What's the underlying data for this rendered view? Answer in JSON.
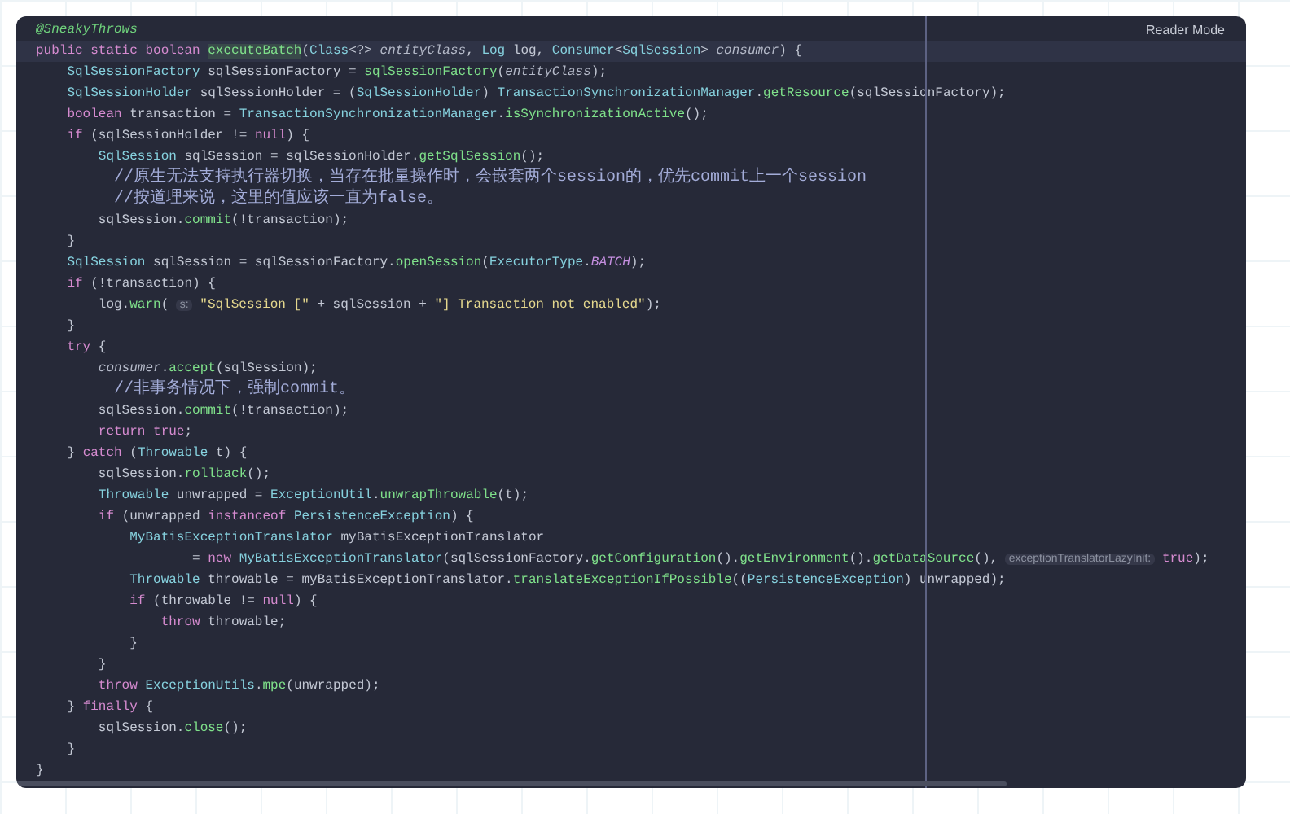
{
  "toolbar": {
    "reader_mode": "Reader Mode"
  },
  "lines": [
    {
      "current": false,
      "tokens": [
        {
          "kind": "annot",
          "text": "@SneakyThrows"
        }
      ]
    },
    {
      "current": true,
      "tokens": [
        {
          "kind": "kw",
          "text": "public static boolean "
        },
        {
          "kind": "fndecl",
          "text": "executeBatch"
        },
        {
          "kind": "plain",
          "text": "("
        },
        {
          "kind": "type",
          "text": "Class"
        },
        {
          "kind": "plain",
          "text": "<?> "
        },
        {
          "kind": "param",
          "text": "entityClass"
        },
        {
          "kind": "plain",
          "text": ", "
        },
        {
          "kind": "type",
          "text": "Log"
        },
        {
          "kind": "plain",
          "text": " log, "
        },
        {
          "kind": "type",
          "text": "Consumer"
        },
        {
          "kind": "plain",
          "text": "<"
        },
        {
          "kind": "type",
          "text": "SqlSession"
        },
        {
          "kind": "plain",
          "text": "> "
        },
        {
          "kind": "param",
          "text": "consumer"
        },
        {
          "kind": "plain",
          "text": ") {"
        }
      ]
    },
    {
      "current": false,
      "tokens": [
        {
          "kind": "type",
          "text": "    SqlSessionFactory"
        },
        {
          "kind": "plain",
          "text": " sqlSessionFactory = "
        },
        {
          "kind": "fn",
          "text": "sqlSessionFactory"
        },
        {
          "kind": "plain",
          "text": "("
        },
        {
          "kind": "param",
          "text": "entityClass"
        },
        {
          "kind": "plain",
          "text": ");"
        }
      ]
    },
    {
      "current": false,
      "tokens": [
        {
          "kind": "type",
          "text": "    SqlSessionHolder"
        },
        {
          "kind": "plain",
          "text": " sqlSessionHolder = ("
        },
        {
          "kind": "type",
          "text": "SqlSessionHolder"
        },
        {
          "kind": "plain",
          "text": ") "
        },
        {
          "kind": "type",
          "text": "TransactionSynchronizationManager"
        },
        {
          "kind": "plain",
          "text": "."
        },
        {
          "kind": "fn",
          "text": "getResource"
        },
        {
          "kind": "plain",
          "text": "(sqlSessionFactory);"
        }
      ]
    },
    {
      "current": false,
      "tokens": [
        {
          "kind": "kw",
          "text": "    boolean"
        },
        {
          "kind": "plain",
          "text": " transaction = "
        },
        {
          "kind": "type",
          "text": "TransactionSynchronizationManager"
        },
        {
          "kind": "plain",
          "text": "."
        },
        {
          "kind": "fn",
          "text": "isSynchronizationActive"
        },
        {
          "kind": "plain",
          "text": "();"
        }
      ]
    },
    {
      "current": false,
      "tokens": [
        {
          "kind": "kw",
          "text": "    if"
        },
        {
          "kind": "plain",
          "text": " (sqlSessionHolder != "
        },
        {
          "kind": "kw",
          "text": "null"
        },
        {
          "kind": "plain",
          "text": ") {"
        }
      ]
    },
    {
      "current": false,
      "tokens": [
        {
          "kind": "type",
          "text": "        SqlSession"
        },
        {
          "kind": "plain",
          "text": " sqlSession = sqlSessionHolder."
        },
        {
          "kind": "fn",
          "text": "getSqlSession"
        },
        {
          "kind": "plain",
          "text": "();"
        }
      ]
    },
    {
      "current": false,
      "tokens": [
        {
          "kind": "comment",
          "text": "        //原生无法支持执行器切换，当存在批量操作时，会嵌套两个session的，优先commit上一个session"
        }
      ]
    },
    {
      "current": false,
      "tokens": [
        {
          "kind": "comment",
          "text": "        //按道理来说，这里的值应该一直为false。"
        }
      ]
    },
    {
      "current": false,
      "tokens": [
        {
          "kind": "plain",
          "text": "        sqlSession."
        },
        {
          "kind": "fn",
          "text": "commit"
        },
        {
          "kind": "plain",
          "text": "(!transaction);"
        }
      ]
    },
    {
      "current": false,
      "tokens": [
        {
          "kind": "plain",
          "text": "    }"
        }
      ]
    },
    {
      "current": false,
      "tokens": [
        {
          "kind": "type",
          "text": "    SqlSession"
        },
        {
          "kind": "plain",
          "text": " sqlSession = sqlSessionFactory."
        },
        {
          "kind": "fn",
          "text": "openSession"
        },
        {
          "kind": "plain",
          "text": "("
        },
        {
          "kind": "type",
          "text": "ExecutorType"
        },
        {
          "kind": "plain",
          "text": "."
        },
        {
          "kind": "const",
          "text": "BATCH"
        },
        {
          "kind": "plain",
          "text": ");"
        }
      ]
    },
    {
      "current": false,
      "tokens": [
        {
          "kind": "kw",
          "text": "    if"
        },
        {
          "kind": "plain",
          "text": " (!transaction) {"
        }
      ]
    },
    {
      "current": false,
      "tokens": [
        {
          "kind": "plain",
          "text": "        log."
        },
        {
          "kind": "fn",
          "text": "warn"
        },
        {
          "kind": "plain",
          "text": "( "
        },
        {
          "kind": "hint",
          "text": "s:"
        },
        {
          "kind": "str",
          "text": " \"SqlSession [\""
        },
        {
          "kind": "plain",
          "text": " + sqlSession + "
        },
        {
          "kind": "str",
          "text": "\"] Transaction not enabled\""
        },
        {
          "kind": "plain",
          "text": ");"
        }
      ]
    },
    {
      "current": false,
      "tokens": [
        {
          "kind": "plain",
          "text": "    }"
        }
      ]
    },
    {
      "current": false,
      "tokens": [
        {
          "kind": "kw",
          "text": "    try"
        },
        {
          "kind": "plain",
          "text": " {"
        }
      ]
    },
    {
      "current": false,
      "tokens": [
        {
          "kind": "param",
          "text": "        consumer"
        },
        {
          "kind": "plain",
          "text": "."
        },
        {
          "kind": "fn",
          "text": "accept"
        },
        {
          "kind": "plain",
          "text": "(sqlSession);"
        }
      ]
    },
    {
      "current": false,
      "tokens": [
        {
          "kind": "comment",
          "text": "        //非事务情况下，强制commit。"
        }
      ]
    },
    {
      "current": false,
      "tokens": [
        {
          "kind": "plain",
          "text": "        sqlSession."
        },
        {
          "kind": "fn",
          "text": "commit"
        },
        {
          "kind": "plain",
          "text": "(!transaction);"
        }
      ]
    },
    {
      "current": false,
      "tokens": [
        {
          "kind": "kw",
          "text": "        return true"
        },
        {
          "kind": "plain",
          "text": ";"
        }
      ]
    },
    {
      "current": false,
      "tokens": [
        {
          "kind": "plain",
          "text": "    } "
        },
        {
          "kind": "kw",
          "text": "catch"
        },
        {
          "kind": "plain",
          "text": " ("
        },
        {
          "kind": "type",
          "text": "Throwable"
        },
        {
          "kind": "plain",
          "text": " t) {"
        }
      ]
    },
    {
      "current": false,
      "tokens": [
        {
          "kind": "plain",
          "text": "        sqlSession."
        },
        {
          "kind": "fn",
          "text": "rollback"
        },
        {
          "kind": "plain",
          "text": "();"
        }
      ]
    },
    {
      "current": false,
      "tokens": [
        {
          "kind": "type",
          "text": "        Throwable"
        },
        {
          "kind": "plain",
          "text": " unwrapped = "
        },
        {
          "kind": "type",
          "text": "ExceptionUtil"
        },
        {
          "kind": "plain",
          "text": "."
        },
        {
          "kind": "fn",
          "text": "unwrapThrowable"
        },
        {
          "kind": "plain",
          "text": "(t);"
        }
      ]
    },
    {
      "current": false,
      "tokens": [
        {
          "kind": "kw",
          "text": "        if"
        },
        {
          "kind": "plain",
          "text": " (unwrapped "
        },
        {
          "kind": "kw",
          "text": "instanceof "
        },
        {
          "kind": "type",
          "text": "PersistenceException"
        },
        {
          "kind": "plain",
          "text": ") {"
        }
      ]
    },
    {
      "current": false,
      "tokens": [
        {
          "kind": "type",
          "text": "            MyBatisExceptionTranslator"
        },
        {
          "kind": "plain",
          "text": " myBatisExceptionTranslator"
        }
      ]
    },
    {
      "current": false,
      "tokens": [
        {
          "kind": "plain",
          "text": "                    = "
        },
        {
          "kind": "kw",
          "text": "new "
        },
        {
          "kind": "type",
          "text": "MyBatisExceptionTranslator"
        },
        {
          "kind": "plain",
          "text": "(sqlSessionFactory."
        },
        {
          "kind": "fn",
          "text": "getConfiguration"
        },
        {
          "kind": "plain",
          "text": "()."
        },
        {
          "kind": "fn",
          "text": "getEnvironment"
        },
        {
          "kind": "plain",
          "text": "()."
        },
        {
          "kind": "fn",
          "text": "getDataSource"
        },
        {
          "kind": "plain",
          "text": "(), "
        },
        {
          "kind": "hint",
          "text": "exceptionTranslatorLazyInit:"
        },
        {
          "kind": "kw",
          "text": " true"
        },
        {
          "kind": "plain",
          "text": ");"
        }
      ]
    },
    {
      "current": false,
      "tokens": [
        {
          "kind": "type",
          "text": "            Throwable"
        },
        {
          "kind": "plain",
          "text": " throwable = myBatisExceptionTranslator."
        },
        {
          "kind": "fn",
          "text": "translateExceptionIfPossible"
        },
        {
          "kind": "plain",
          "text": "(("
        },
        {
          "kind": "type",
          "text": "PersistenceException"
        },
        {
          "kind": "plain",
          "text": ") unwrapped);"
        }
      ]
    },
    {
      "current": false,
      "tokens": [
        {
          "kind": "kw",
          "text": "            if"
        },
        {
          "kind": "plain",
          "text": " (throwable != "
        },
        {
          "kind": "kw",
          "text": "null"
        },
        {
          "kind": "plain",
          "text": ") {"
        }
      ]
    },
    {
      "current": false,
      "tokens": [
        {
          "kind": "kw",
          "text": "                throw"
        },
        {
          "kind": "plain",
          "text": " throwable;"
        }
      ]
    },
    {
      "current": false,
      "tokens": [
        {
          "kind": "plain",
          "text": "            }"
        }
      ]
    },
    {
      "current": false,
      "tokens": [
        {
          "kind": "plain",
          "text": "        }"
        }
      ]
    },
    {
      "current": false,
      "tokens": [
        {
          "kind": "kw",
          "text": "        throw "
        },
        {
          "kind": "type",
          "text": "ExceptionUtils"
        },
        {
          "kind": "plain",
          "text": "."
        },
        {
          "kind": "fn",
          "text": "mpe"
        },
        {
          "kind": "plain",
          "text": "(unwrapped);"
        }
      ]
    },
    {
      "current": false,
      "tokens": [
        {
          "kind": "plain",
          "text": "    } "
        },
        {
          "kind": "kw",
          "text": "finally"
        },
        {
          "kind": "plain",
          "text": " {"
        }
      ]
    },
    {
      "current": false,
      "tokens": [
        {
          "kind": "plain",
          "text": "        sqlSession."
        },
        {
          "kind": "fn",
          "text": "close"
        },
        {
          "kind": "plain",
          "text": "();"
        }
      ]
    },
    {
      "current": false,
      "tokens": [
        {
          "kind": "plain",
          "text": "    }"
        }
      ]
    },
    {
      "current": false,
      "tokens": [
        {
          "kind": "plain",
          "text": "}"
        }
      ]
    }
  ]
}
